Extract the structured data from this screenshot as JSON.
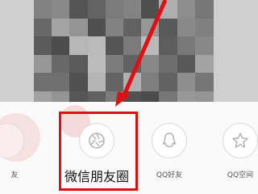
{
  "share_options": [
    {
      "id": "partial",
      "label": "友",
      "icon": "contact-icon"
    },
    {
      "id": "wechat-moments",
      "label": "微信朋友圈",
      "icon": "moments-shutter-icon"
    },
    {
      "id": "qq-friends",
      "label": "QQ好友",
      "icon": "qq-penguin-icon"
    },
    {
      "id": "qq-zone",
      "label": "QQ空间",
      "icon": "qzone-star-icon"
    }
  ],
  "colors": {
    "annotation": "#e01010",
    "sheet_bg": "#fafafa",
    "icon_stroke": "#b0b0b0"
  }
}
